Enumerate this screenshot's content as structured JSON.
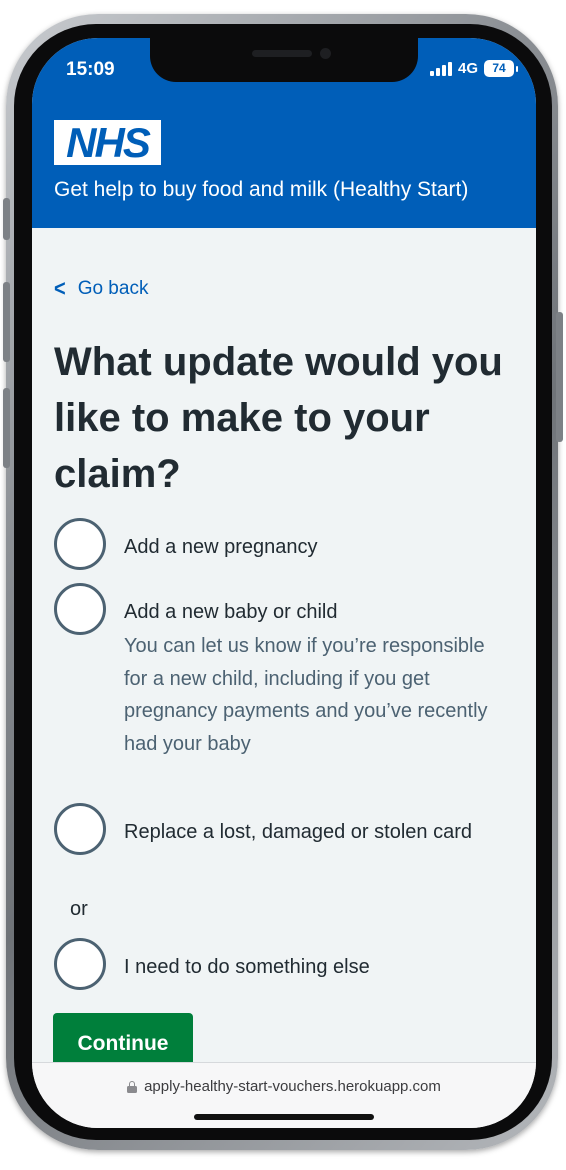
{
  "status_bar": {
    "time": "15:09",
    "network": "4G",
    "battery": "74"
  },
  "header": {
    "logo_text": "NHS",
    "service_name": "Get help to buy food and milk (Healthy Start)"
  },
  "main": {
    "back_link": "Go back",
    "title": "What update would you like to make to your claim?",
    "options": [
      {
        "label": "Add a new pregnancy",
        "hint": ""
      },
      {
        "label": "Add a new baby or child",
        "hint": "You can let us know if you’re responsible for a new child, including if you get pregnancy payments and you’ve recently had your baby"
      },
      {
        "label": "Replace a lost, damaged or stolen card",
        "hint": ""
      },
      {
        "label": "I need to do something else",
        "hint": ""
      }
    ],
    "divider": "or",
    "continue_label": "Continue"
  },
  "browser": {
    "url": "apply-healthy-start-vouchers.herokuapp.com"
  },
  "colors": {
    "nhs_blue": "#005eb8",
    "background": "#f0f4f5",
    "text": "#212b32",
    "secondary_text": "#4c6272",
    "button_green": "#007f3b"
  },
  "icons": {
    "back": "chevron-left-icon",
    "signal": "cellular-signal-icon",
    "battery": "battery-icon",
    "lock": "lock-icon"
  }
}
